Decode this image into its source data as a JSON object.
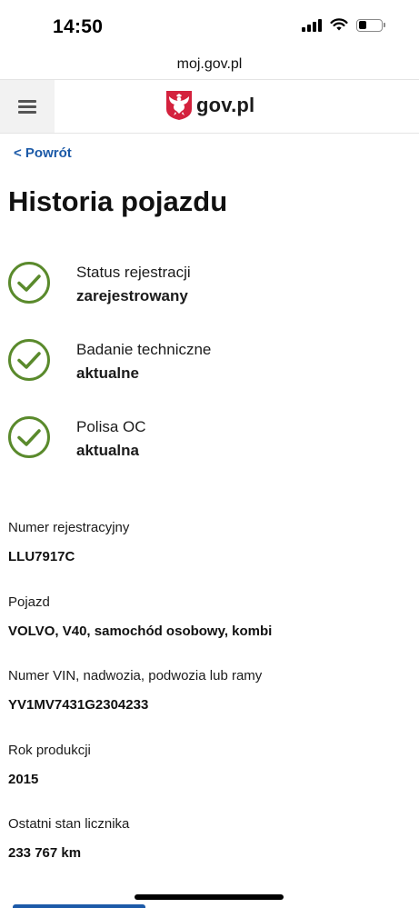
{
  "status_bar": {
    "time": "14:50"
  },
  "browser": {
    "url": "moj.gov.pl"
  },
  "header": {
    "brand": "gov.pl",
    "menu_icon": "hamburger-icon",
    "emblem_icon": "polish-eagle-icon"
  },
  "nav": {
    "back_label": "< Powrót"
  },
  "page": {
    "title": "Historia pojazdu"
  },
  "statuses": [
    {
      "label": "Status rejestracji",
      "value": "zarejestrowany",
      "icon": "check-circle-icon"
    },
    {
      "label": "Badanie techniczne",
      "value": "aktualne",
      "icon": "check-circle-icon"
    },
    {
      "label": "Polisa OC",
      "value": "aktualna",
      "icon": "check-circle-icon"
    }
  ],
  "details": [
    {
      "label": "Numer rejestracyjny",
      "value": "LLU7917C"
    },
    {
      "label": "Pojazd",
      "value": "VOLVO, V40, samochód osobowy, kombi"
    },
    {
      "label": "Numer VIN, nadwozia, podwozia lub ramy",
      "value": "YV1MV7431G2304233"
    },
    {
      "label": "Rok produkcji",
      "value": "2015"
    },
    {
      "label": "Ostatni stan licznika",
      "value": "233 767 km"
    }
  ],
  "colors": {
    "accent": "#1c5aa8",
    "check_green": "#5a8a2c",
    "emblem_red": "#d4213d"
  }
}
